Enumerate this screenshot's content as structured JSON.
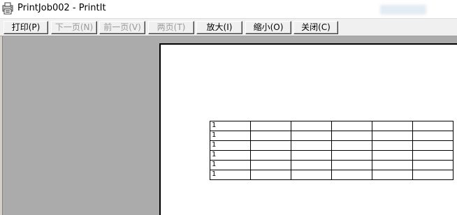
{
  "window": {
    "title": "PrintJob002 - PrintIt",
    "app_icon": "printer-document-icon"
  },
  "toolbar": {
    "buttons": [
      {
        "label": "打印(P)",
        "enabled": true
      },
      {
        "label": "下一页(N)",
        "enabled": false
      },
      {
        "label": "前一页(V)",
        "enabled": false
      },
      {
        "label": "两页(T)",
        "enabled": false
      },
      {
        "label": "放大(I)",
        "enabled": true
      },
      {
        "label": "缩小(O)",
        "enabled": true
      },
      {
        "label": "关闭(C)",
        "enabled": true
      }
    ]
  },
  "preview": {
    "table": {
      "columns": 6,
      "rows": [
        [
          "1",
          "",
          "",
          "",
          "",
          ""
        ],
        [
          "1",
          "",
          "",
          "",
          "",
          ""
        ],
        [
          "1",
          "",
          "",
          "",
          "",
          ""
        ],
        [
          "1",
          "",
          "",
          "",
          "",
          ""
        ],
        [
          "1",
          "",
          "",
          "",
          "",
          ""
        ],
        [
          "1",
          "",
          "",
          "",
          "",
          ""
        ]
      ]
    }
  },
  "colors": {
    "preview_background": "#ababab",
    "toolbar_background": "#f0f0f0",
    "disabled_text": "#9a9a9a"
  }
}
